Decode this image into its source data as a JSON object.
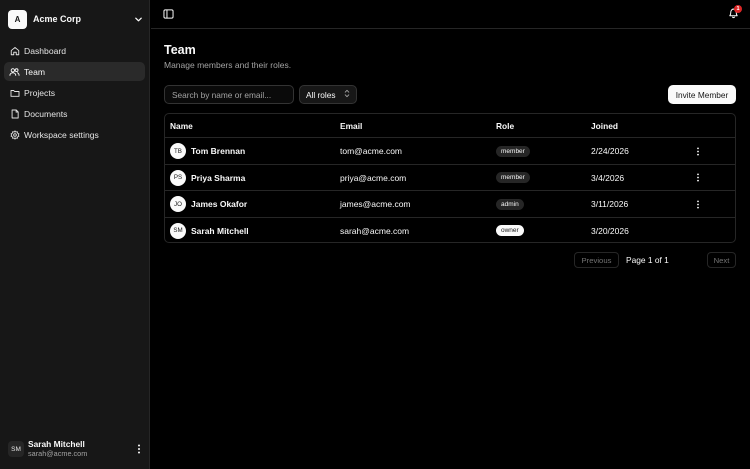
{
  "sidebar": {
    "org": {
      "logo_letter": "A",
      "name": "Acme Corp"
    },
    "items": [
      {
        "label": "Dashboard",
        "icon": "home-icon",
        "active": false
      },
      {
        "label": "Team",
        "icon": "users-icon",
        "active": true
      },
      {
        "label": "Projects",
        "icon": "folder-icon",
        "active": false
      },
      {
        "label": "Documents",
        "icon": "file-icon",
        "active": false
      },
      {
        "label": "Workspace settings",
        "icon": "gear-icon",
        "active": false
      }
    ],
    "user": {
      "initials": "SM",
      "name": "Sarah Mitchell",
      "email": "sarah@acme.com"
    }
  },
  "topbar": {
    "notification_count": "1"
  },
  "page": {
    "title": "Team",
    "subtitle": "Manage members and their roles."
  },
  "toolbar": {
    "search_placeholder": "Search by name or email...",
    "role_filter": "All roles",
    "invite_label": "Invite Member"
  },
  "table": {
    "columns": [
      "Name",
      "Email",
      "Role",
      "Joined"
    ],
    "rows": [
      {
        "initials": "TB",
        "name": "Tom Brennan",
        "email": "tom@acme.com",
        "role": "member",
        "joined": "2/24/2026",
        "menu": true
      },
      {
        "initials": "PS",
        "name": "Priya Sharma",
        "email": "priya@acme.com",
        "role": "member",
        "joined": "3/4/2026",
        "menu": true
      },
      {
        "initials": "JO",
        "name": "James Okafor",
        "email": "james@acme.com",
        "role": "admin",
        "joined": "3/11/2026",
        "menu": true
      },
      {
        "initials": "SM",
        "name": "Sarah Mitchell",
        "email": "sarah@acme.com",
        "role": "owner",
        "joined": "3/20/2026",
        "menu": false
      }
    ]
  },
  "pagination": {
    "prev_label": "Previous",
    "page_label": "Page 1 of 1",
    "next_label": "Next"
  },
  "colors": {
    "background": "#000000",
    "sidebar": "#171717",
    "accent": "#fafafa",
    "badge_alert": "#dc2626"
  }
}
